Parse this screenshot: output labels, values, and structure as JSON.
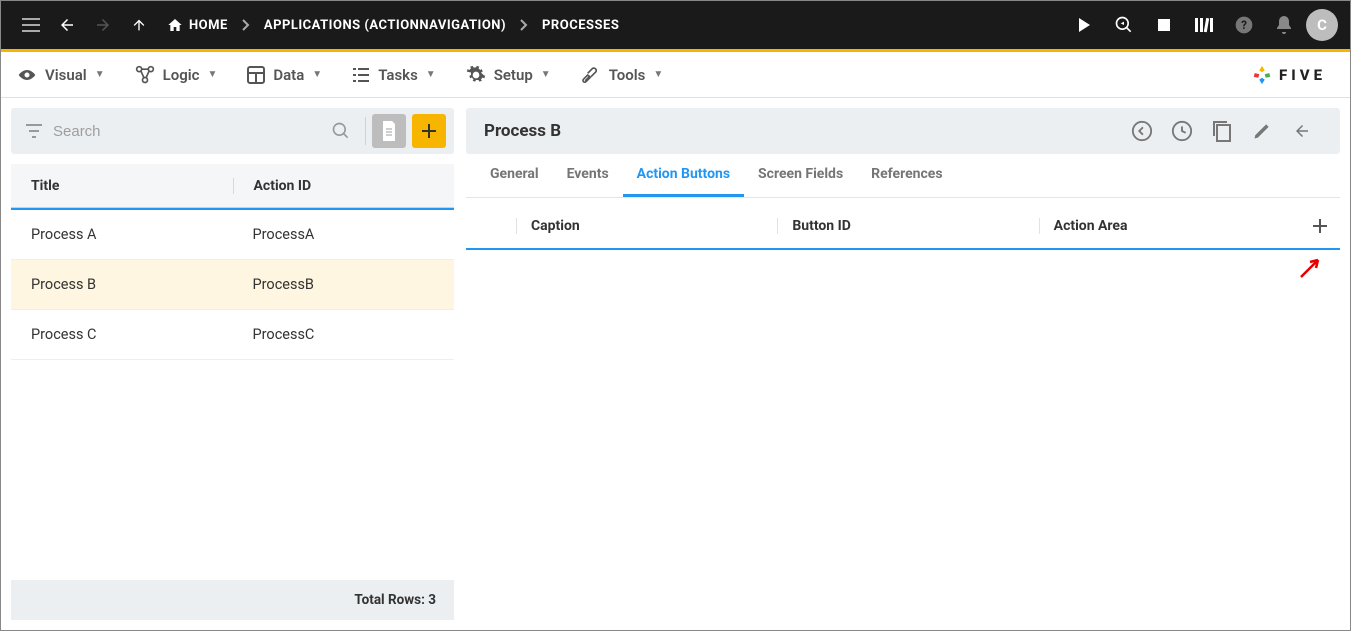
{
  "topbar": {
    "breadcrumbs": {
      "home": "HOME",
      "apps": "APPLICATIONS (ACTIONNAVIGATION)",
      "processes": "PROCESSES"
    },
    "avatar_letter": "C"
  },
  "menubar": {
    "visual": "Visual",
    "logic": "Logic",
    "data": "Data",
    "tasks": "Tasks",
    "setup": "Setup",
    "tools": "Tools",
    "logo_text": "FIVE"
  },
  "left": {
    "search_placeholder": "Search",
    "columns": {
      "title": "Title",
      "action_id": "Action ID"
    },
    "rows": [
      {
        "title": "Process A",
        "action_id": "ProcessA"
      },
      {
        "title": "Process B",
        "action_id": "ProcessB"
      },
      {
        "title": "Process C",
        "action_id": "ProcessC"
      }
    ],
    "selected_index": 1,
    "footer": "Total Rows: 3"
  },
  "right": {
    "title": "Process B",
    "tabs": {
      "general": "General",
      "events": "Events",
      "action_buttons": "Action Buttons",
      "screen_fields": "Screen Fields",
      "references": "References"
    },
    "active_tab": "action_buttons",
    "grid_cols": {
      "caption": "Caption",
      "button_id": "Button ID",
      "action_area": "Action Area"
    }
  }
}
